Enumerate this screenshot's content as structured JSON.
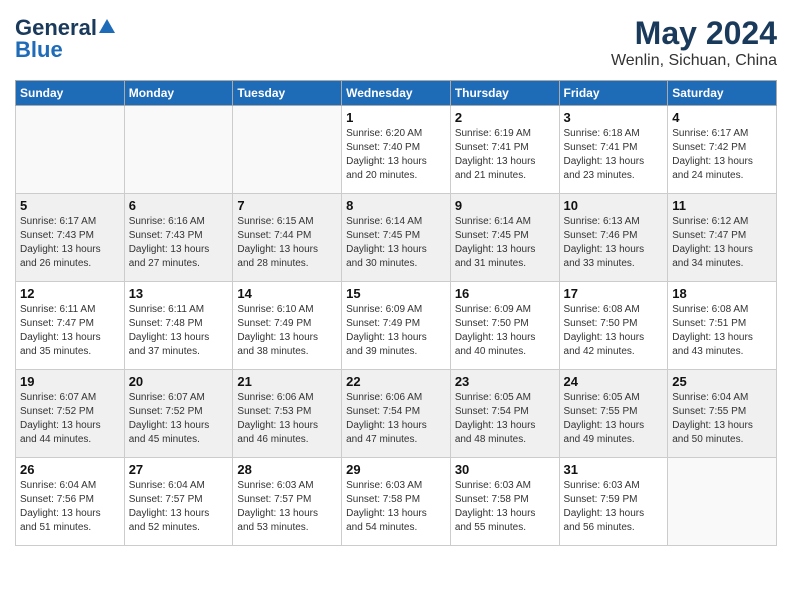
{
  "header": {
    "logo_general": "General",
    "logo_blue": "Blue",
    "title": "May 2024",
    "subtitle": "Wenlin, Sichuan, China"
  },
  "days_of_week": [
    "Sunday",
    "Monday",
    "Tuesday",
    "Wednesday",
    "Thursday",
    "Friday",
    "Saturday"
  ],
  "weeks": [
    [
      {
        "day": "",
        "info": ""
      },
      {
        "day": "",
        "info": ""
      },
      {
        "day": "",
        "info": ""
      },
      {
        "day": "1",
        "info": "Sunrise: 6:20 AM\nSunset: 7:40 PM\nDaylight: 13 hours\nand 20 minutes."
      },
      {
        "day": "2",
        "info": "Sunrise: 6:19 AM\nSunset: 7:41 PM\nDaylight: 13 hours\nand 21 minutes."
      },
      {
        "day": "3",
        "info": "Sunrise: 6:18 AM\nSunset: 7:41 PM\nDaylight: 13 hours\nand 23 minutes."
      },
      {
        "day": "4",
        "info": "Sunrise: 6:17 AM\nSunset: 7:42 PM\nDaylight: 13 hours\nand 24 minutes."
      }
    ],
    [
      {
        "day": "5",
        "info": "Sunrise: 6:17 AM\nSunset: 7:43 PM\nDaylight: 13 hours\nand 26 minutes."
      },
      {
        "day": "6",
        "info": "Sunrise: 6:16 AM\nSunset: 7:43 PM\nDaylight: 13 hours\nand 27 minutes."
      },
      {
        "day": "7",
        "info": "Sunrise: 6:15 AM\nSunset: 7:44 PM\nDaylight: 13 hours\nand 28 minutes."
      },
      {
        "day": "8",
        "info": "Sunrise: 6:14 AM\nSunset: 7:45 PM\nDaylight: 13 hours\nand 30 minutes."
      },
      {
        "day": "9",
        "info": "Sunrise: 6:14 AM\nSunset: 7:45 PM\nDaylight: 13 hours\nand 31 minutes."
      },
      {
        "day": "10",
        "info": "Sunrise: 6:13 AM\nSunset: 7:46 PM\nDaylight: 13 hours\nand 33 minutes."
      },
      {
        "day": "11",
        "info": "Sunrise: 6:12 AM\nSunset: 7:47 PM\nDaylight: 13 hours\nand 34 minutes."
      }
    ],
    [
      {
        "day": "12",
        "info": "Sunrise: 6:11 AM\nSunset: 7:47 PM\nDaylight: 13 hours\nand 35 minutes."
      },
      {
        "day": "13",
        "info": "Sunrise: 6:11 AM\nSunset: 7:48 PM\nDaylight: 13 hours\nand 37 minutes."
      },
      {
        "day": "14",
        "info": "Sunrise: 6:10 AM\nSunset: 7:49 PM\nDaylight: 13 hours\nand 38 minutes."
      },
      {
        "day": "15",
        "info": "Sunrise: 6:09 AM\nSunset: 7:49 PM\nDaylight: 13 hours\nand 39 minutes."
      },
      {
        "day": "16",
        "info": "Sunrise: 6:09 AM\nSunset: 7:50 PM\nDaylight: 13 hours\nand 40 minutes."
      },
      {
        "day": "17",
        "info": "Sunrise: 6:08 AM\nSunset: 7:50 PM\nDaylight: 13 hours\nand 42 minutes."
      },
      {
        "day": "18",
        "info": "Sunrise: 6:08 AM\nSunset: 7:51 PM\nDaylight: 13 hours\nand 43 minutes."
      }
    ],
    [
      {
        "day": "19",
        "info": "Sunrise: 6:07 AM\nSunset: 7:52 PM\nDaylight: 13 hours\nand 44 minutes."
      },
      {
        "day": "20",
        "info": "Sunrise: 6:07 AM\nSunset: 7:52 PM\nDaylight: 13 hours\nand 45 minutes."
      },
      {
        "day": "21",
        "info": "Sunrise: 6:06 AM\nSunset: 7:53 PM\nDaylight: 13 hours\nand 46 minutes."
      },
      {
        "day": "22",
        "info": "Sunrise: 6:06 AM\nSunset: 7:54 PM\nDaylight: 13 hours\nand 47 minutes."
      },
      {
        "day": "23",
        "info": "Sunrise: 6:05 AM\nSunset: 7:54 PM\nDaylight: 13 hours\nand 48 minutes."
      },
      {
        "day": "24",
        "info": "Sunrise: 6:05 AM\nSunset: 7:55 PM\nDaylight: 13 hours\nand 49 minutes."
      },
      {
        "day": "25",
        "info": "Sunrise: 6:04 AM\nSunset: 7:55 PM\nDaylight: 13 hours\nand 50 minutes."
      }
    ],
    [
      {
        "day": "26",
        "info": "Sunrise: 6:04 AM\nSunset: 7:56 PM\nDaylight: 13 hours\nand 51 minutes."
      },
      {
        "day": "27",
        "info": "Sunrise: 6:04 AM\nSunset: 7:57 PM\nDaylight: 13 hours\nand 52 minutes."
      },
      {
        "day": "28",
        "info": "Sunrise: 6:03 AM\nSunset: 7:57 PM\nDaylight: 13 hours\nand 53 minutes."
      },
      {
        "day": "29",
        "info": "Sunrise: 6:03 AM\nSunset: 7:58 PM\nDaylight: 13 hours\nand 54 minutes."
      },
      {
        "day": "30",
        "info": "Sunrise: 6:03 AM\nSunset: 7:58 PM\nDaylight: 13 hours\nand 55 minutes."
      },
      {
        "day": "31",
        "info": "Sunrise: 6:03 AM\nSunset: 7:59 PM\nDaylight: 13 hours\nand 56 minutes."
      },
      {
        "day": "",
        "info": ""
      }
    ]
  ]
}
